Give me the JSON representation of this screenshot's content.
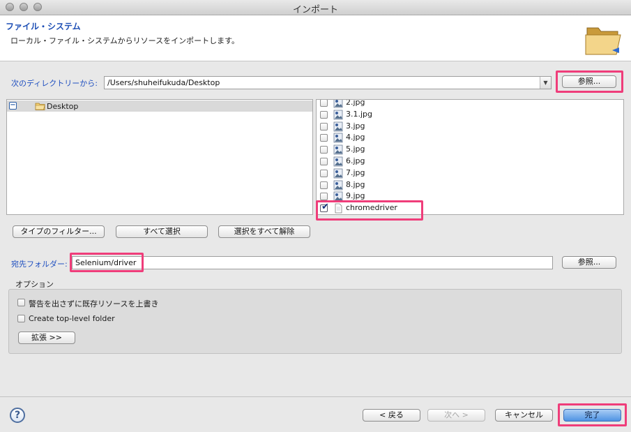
{
  "window": {
    "title": "インポート"
  },
  "header": {
    "title": "ファイル・システム",
    "description": "ローカル・ファイル・システムからリソースをインポートします。"
  },
  "source": {
    "label": "次のディレクトリーから:",
    "path": "/Users/shuheifukuda/Desktop",
    "browse_label": "参照..."
  },
  "tree": {
    "expander": "−",
    "items": [
      {
        "label": "Desktop"
      }
    ]
  },
  "files": [
    {
      "name": "2.jpg",
      "checked": false
    },
    {
      "name": "3.1.jpg",
      "checked": false
    },
    {
      "name": "3.jpg",
      "checked": false
    },
    {
      "name": "4.jpg",
      "checked": false
    },
    {
      "name": "5.jpg",
      "checked": false
    },
    {
      "name": "6.jpg",
      "checked": false
    },
    {
      "name": "7.jpg",
      "checked": false
    },
    {
      "name": "8.jpg",
      "checked": false
    },
    {
      "name": "9.jpg",
      "checked": false
    },
    {
      "name": "chromedriver",
      "checked": true
    }
  ],
  "selection_buttons": {
    "filter_types": "タイプのフィルター...",
    "select_all": "すべて選択",
    "deselect_all": "選択をすべて解除"
  },
  "destination": {
    "label": "宛先フォルダー:",
    "value": "Selenium/driver",
    "browse_label": "参照..."
  },
  "options": {
    "legend": "オプション",
    "overwrite_label": "警告を出さずに既存リソースを上書き",
    "overwrite_checked": false,
    "toplevel_label": "Create top-level folder",
    "toplevel_checked": false,
    "advanced_label": "拡張 >>"
  },
  "footer": {
    "help_symbol": "?",
    "back_label": "< 戻る",
    "next_label": "次へ >",
    "cancel_label": "キャンセル",
    "finish_label": "完了"
  },
  "colors": {
    "highlight": "#ef3d7a",
    "label_blue": "#1f4fc0",
    "primary_button": "#4f93e3"
  },
  "icons": {
    "window_controls": [
      "close-icon",
      "minimize-icon",
      "zoom-icon"
    ],
    "header": "folder-open-icon",
    "tree_folder": "folder-icon",
    "image_file": "image-file-icon",
    "plain_file": "document-file-icon",
    "help": "help-icon"
  }
}
